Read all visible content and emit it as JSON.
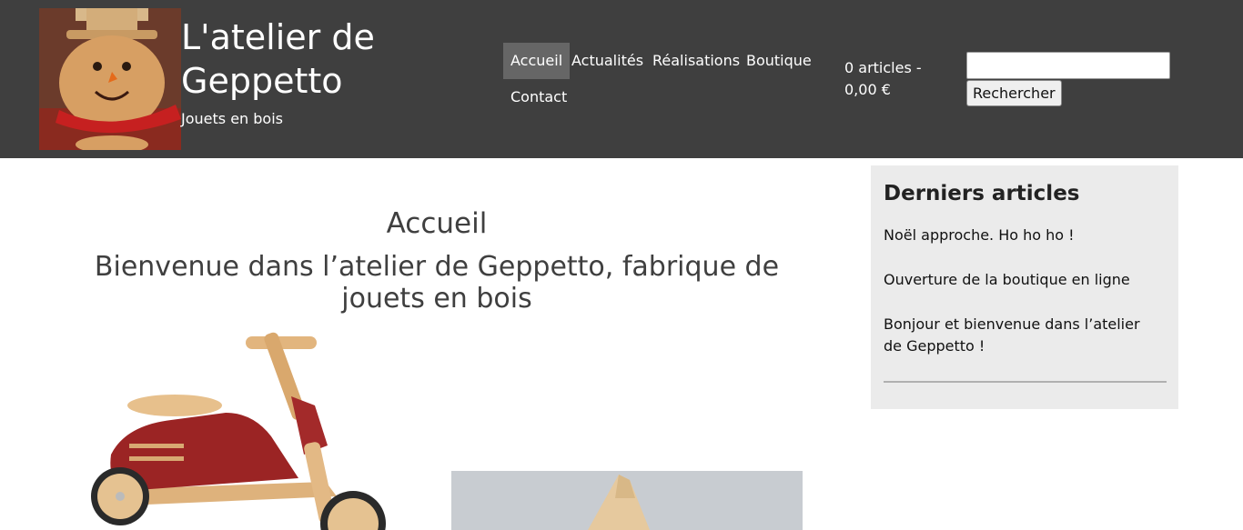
{
  "site": {
    "title": "L'atelier de Geppetto",
    "tagline": "Jouets en bois",
    "logo_icon": "wooden-snowman-logo"
  },
  "nav": {
    "items": [
      {
        "label": "Accueil",
        "active": true
      },
      {
        "label": "Actualités",
        "active": false
      },
      {
        "label": "Réalisations",
        "active": false
      },
      {
        "label": "Boutique",
        "active": false
      },
      {
        "label": "Contact",
        "active": false
      }
    ]
  },
  "cart": {
    "summary": "0 articles - 0,00 €"
  },
  "search": {
    "value": "",
    "placeholder": "",
    "button_label": "Rechercher"
  },
  "main": {
    "title": "Accueil",
    "subtitle": "Bienvenue dans l’atelier de Geppetto, fabrique de jouets en bois",
    "images": [
      "wooden-scooter-image",
      "wooden-toy-image"
    ]
  },
  "sidebar": {
    "heading": "Derniers articles",
    "posts": [
      "Noël approche. Ho ho ho !",
      "Ouverture de la boutique en ligne",
      "Bonjour et bienvenue dans l’atelier de Geppetto !"
    ]
  },
  "colors": {
    "header_bg": "#3f3f3f",
    "nav_active_bg": "#666666",
    "sidebar_bg": "#ebebeb",
    "heading_text": "#3f3f3f"
  }
}
